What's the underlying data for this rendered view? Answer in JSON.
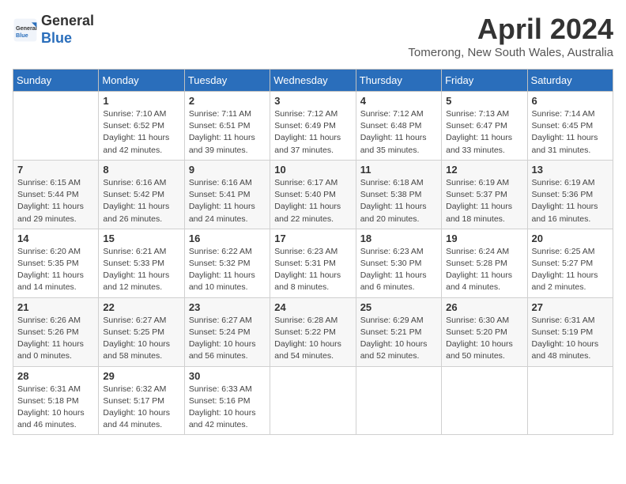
{
  "logo": {
    "line1": "General",
    "line2": "Blue"
  },
  "title": "April 2024",
  "subtitle": "Tomerong, New South Wales, Australia",
  "days_of_week": [
    "Sunday",
    "Monday",
    "Tuesday",
    "Wednesday",
    "Thursday",
    "Friday",
    "Saturday"
  ],
  "weeks": [
    [
      {
        "day": "",
        "info": ""
      },
      {
        "day": "1",
        "info": "Sunrise: 7:10 AM\nSunset: 6:52 PM\nDaylight: 11 hours\nand 42 minutes."
      },
      {
        "day": "2",
        "info": "Sunrise: 7:11 AM\nSunset: 6:51 PM\nDaylight: 11 hours\nand 39 minutes."
      },
      {
        "day": "3",
        "info": "Sunrise: 7:12 AM\nSunset: 6:49 PM\nDaylight: 11 hours\nand 37 minutes."
      },
      {
        "day": "4",
        "info": "Sunrise: 7:12 AM\nSunset: 6:48 PM\nDaylight: 11 hours\nand 35 minutes."
      },
      {
        "day": "5",
        "info": "Sunrise: 7:13 AM\nSunset: 6:47 PM\nDaylight: 11 hours\nand 33 minutes."
      },
      {
        "day": "6",
        "info": "Sunrise: 7:14 AM\nSunset: 6:45 PM\nDaylight: 11 hours\nand 31 minutes."
      }
    ],
    [
      {
        "day": "7",
        "info": "Sunrise: 6:15 AM\nSunset: 5:44 PM\nDaylight: 11 hours\nand 29 minutes."
      },
      {
        "day": "8",
        "info": "Sunrise: 6:16 AM\nSunset: 5:42 PM\nDaylight: 11 hours\nand 26 minutes."
      },
      {
        "day": "9",
        "info": "Sunrise: 6:16 AM\nSunset: 5:41 PM\nDaylight: 11 hours\nand 24 minutes."
      },
      {
        "day": "10",
        "info": "Sunrise: 6:17 AM\nSunset: 5:40 PM\nDaylight: 11 hours\nand 22 minutes."
      },
      {
        "day": "11",
        "info": "Sunrise: 6:18 AM\nSunset: 5:38 PM\nDaylight: 11 hours\nand 20 minutes."
      },
      {
        "day": "12",
        "info": "Sunrise: 6:19 AM\nSunset: 5:37 PM\nDaylight: 11 hours\nand 18 minutes."
      },
      {
        "day": "13",
        "info": "Sunrise: 6:19 AM\nSunset: 5:36 PM\nDaylight: 11 hours\nand 16 minutes."
      }
    ],
    [
      {
        "day": "14",
        "info": "Sunrise: 6:20 AM\nSunset: 5:35 PM\nDaylight: 11 hours\nand 14 minutes."
      },
      {
        "day": "15",
        "info": "Sunrise: 6:21 AM\nSunset: 5:33 PM\nDaylight: 11 hours\nand 12 minutes."
      },
      {
        "day": "16",
        "info": "Sunrise: 6:22 AM\nSunset: 5:32 PM\nDaylight: 11 hours\nand 10 minutes."
      },
      {
        "day": "17",
        "info": "Sunrise: 6:23 AM\nSunset: 5:31 PM\nDaylight: 11 hours\nand 8 minutes."
      },
      {
        "day": "18",
        "info": "Sunrise: 6:23 AM\nSunset: 5:30 PM\nDaylight: 11 hours\nand 6 minutes."
      },
      {
        "day": "19",
        "info": "Sunrise: 6:24 AM\nSunset: 5:28 PM\nDaylight: 11 hours\nand 4 minutes."
      },
      {
        "day": "20",
        "info": "Sunrise: 6:25 AM\nSunset: 5:27 PM\nDaylight: 11 hours\nand 2 minutes."
      }
    ],
    [
      {
        "day": "21",
        "info": "Sunrise: 6:26 AM\nSunset: 5:26 PM\nDaylight: 11 hours\nand 0 minutes."
      },
      {
        "day": "22",
        "info": "Sunrise: 6:27 AM\nSunset: 5:25 PM\nDaylight: 10 hours\nand 58 minutes."
      },
      {
        "day": "23",
        "info": "Sunrise: 6:27 AM\nSunset: 5:24 PM\nDaylight: 10 hours\nand 56 minutes."
      },
      {
        "day": "24",
        "info": "Sunrise: 6:28 AM\nSunset: 5:22 PM\nDaylight: 10 hours\nand 54 minutes."
      },
      {
        "day": "25",
        "info": "Sunrise: 6:29 AM\nSunset: 5:21 PM\nDaylight: 10 hours\nand 52 minutes."
      },
      {
        "day": "26",
        "info": "Sunrise: 6:30 AM\nSunset: 5:20 PM\nDaylight: 10 hours\nand 50 minutes."
      },
      {
        "day": "27",
        "info": "Sunrise: 6:31 AM\nSunset: 5:19 PM\nDaylight: 10 hours\nand 48 minutes."
      }
    ],
    [
      {
        "day": "28",
        "info": "Sunrise: 6:31 AM\nSunset: 5:18 PM\nDaylight: 10 hours\nand 46 minutes."
      },
      {
        "day": "29",
        "info": "Sunrise: 6:32 AM\nSunset: 5:17 PM\nDaylight: 10 hours\nand 44 minutes."
      },
      {
        "day": "30",
        "info": "Sunrise: 6:33 AM\nSunset: 5:16 PM\nDaylight: 10 hours\nand 42 minutes."
      },
      {
        "day": "",
        "info": ""
      },
      {
        "day": "",
        "info": ""
      },
      {
        "day": "",
        "info": ""
      },
      {
        "day": "",
        "info": ""
      }
    ]
  ]
}
